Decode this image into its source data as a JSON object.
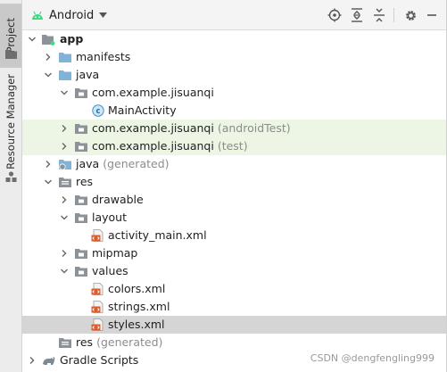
{
  "sidebar": {
    "project_tab": "Project",
    "resource_manager_tab": "Resource Manager"
  },
  "header": {
    "view_mode": "Android"
  },
  "tree": [
    {
      "label": "app",
      "suffix": "",
      "expanded": true,
      "icon": "module-folder-icon"
    },
    {
      "label": "manifests",
      "suffix": "",
      "expanded": false,
      "icon": "folder-icon"
    },
    {
      "label": "java",
      "suffix": "",
      "expanded": true,
      "icon": "source-folder-icon"
    },
    {
      "label": "com.example.jisuanqi",
      "suffix": "",
      "expanded": true,
      "icon": "package-icon"
    },
    {
      "label": "MainActivity",
      "suffix": "",
      "icon": "class-icon"
    },
    {
      "label": "com.example.jisuanqi",
      "suffix": "(androidTest)",
      "expanded": false,
      "icon": "package-icon"
    },
    {
      "label": "com.example.jisuanqi",
      "suffix": "(test)",
      "expanded": false,
      "icon": "package-icon"
    },
    {
      "label": "java",
      "suffix": "(generated)",
      "expanded": false,
      "icon": "generated-folder-icon"
    },
    {
      "label": "res",
      "suffix": "",
      "expanded": true,
      "icon": "res-folder-icon"
    },
    {
      "label": "drawable",
      "suffix": "",
      "expanded": false,
      "icon": "package-icon"
    },
    {
      "label": "layout",
      "suffix": "",
      "expanded": true,
      "icon": "package-icon"
    },
    {
      "label": "activity_main.xml",
      "suffix": "",
      "icon": "xml-file-icon"
    },
    {
      "label": "mipmap",
      "suffix": "",
      "expanded": false,
      "icon": "package-icon"
    },
    {
      "label": "values",
      "suffix": "",
      "expanded": true,
      "icon": "package-icon"
    },
    {
      "label": "colors.xml",
      "suffix": "",
      "icon": "xml-file-icon"
    },
    {
      "label": "strings.xml",
      "suffix": "",
      "icon": "xml-file-icon"
    },
    {
      "label": "styles.xml",
      "suffix": "",
      "icon": "xml-file-icon",
      "selected": true
    },
    {
      "label": "res",
      "suffix": "(generated)",
      "icon": "res-folder-icon"
    },
    {
      "label": "Gradle Scripts",
      "suffix": "",
      "expanded": false,
      "icon": "gradle-icon"
    }
  ],
  "watermark": "CSDN @dengfengling999",
  "colors": {
    "selection": "#d5d5d5",
    "test_highlight": "#edf6e5",
    "folder_blue": "#7fb3d8",
    "package_gray": "#8d9198",
    "android_green": "#3ddc84"
  }
}
